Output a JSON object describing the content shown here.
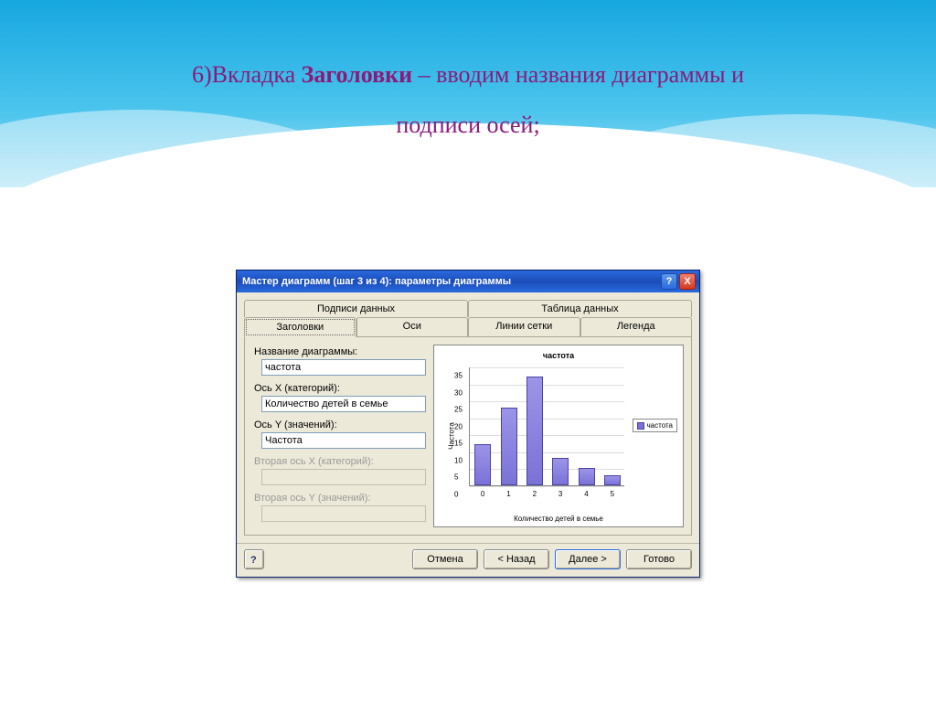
{
  "slide": {
    "title_prefix": "6)Вкладка ",
    "title_bold": "Заголовки",
    "title_suffix": " – вводим названия диаграммы и",
    "title_line2": "подписи осей;"
  },
  "dialog": {
    "title": "Мастер диаграмм (шаг 3 из 4): параметры диаграммы",
    "tabs_top": {
      "data_labels": "Подписи данных",
      "data_table": "Таблица данных"
    },
    "tabs_bottom": {
      "titles": "Заголовки",
      "axes": "Оси",
      "gridlines": "Линии сетки",
      "legend": "Легенда"
    },
    "form": {
      "chart_title_label": "Название диаграммы:",
      "chart_title_value": "частота",
      "x_axis_label": "Ось X (категорий):",
      "x_axis_value": "Количество детей в семье",
      "y_axis_label": "Ось Y (значений):",
      "y_axis_value": "Частота",
      "x2_label": "Вторая ось X (категорий):",
      "y2_label": "Вторая ось Y (значений):"
    },
    "buttons": {
      "cancel": "Отмена",
      "back": "< Назад",
      "next": "Далее >",
      "finish": "Готово",
      "help": "?"
    },
    "titlebar_buttons": {
      "help": "?",
      "close": "X"
    }
  },
  "chart_data": {
    "type": "bar",
    "title": "частота",
    "xlabel": "Количество детей в семье",
    "ylabel": "Частота",
    "categories": [
      "0",
      "1",
      "2",
      "3",
      "4",
      "5"
    ],
    "values": [
      12,
      23,
      32,
      8,
      5,
      3
    ],
    "ylim": [
      0,
      35
    ],
    "yticks": [
      0,
      5,
      10,
      15,
      20,
      25,
      30,
      35
    ],
    "legend": "частота"
  }
}
